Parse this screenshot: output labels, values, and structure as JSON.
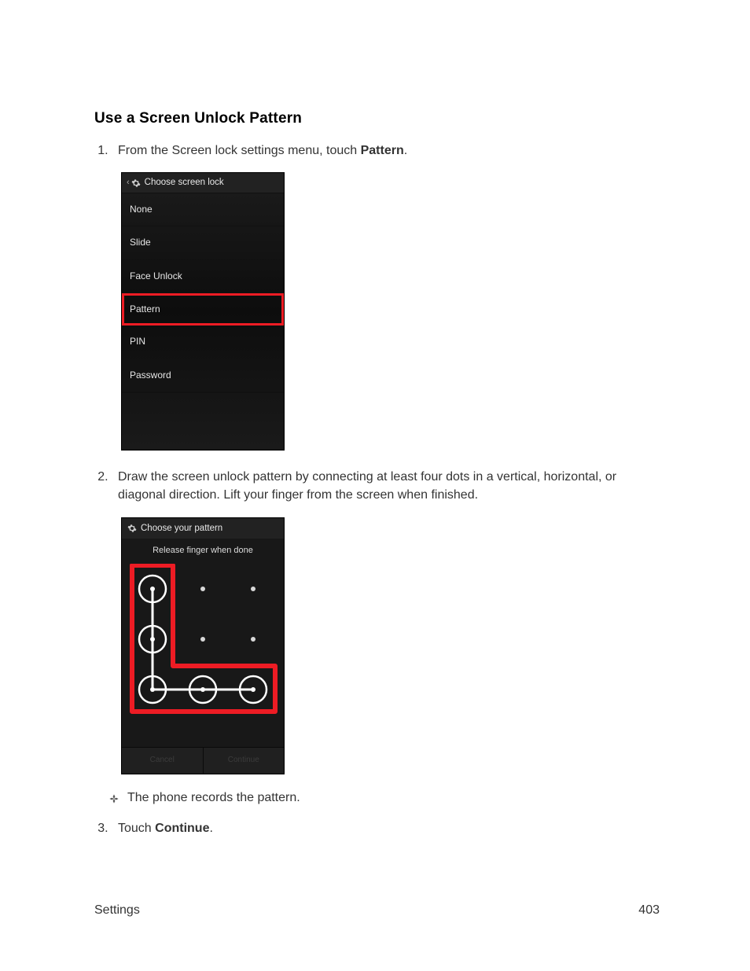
{
  "title": "Use a Screen Unlock Pattern",
  "steps": {
    "one": {
      "prefix": "From the Screen lock settings menu, touch ",
      "bold": "Pattern",
      "suffix": "."
    },
    "two": "Draw the screen unlock pattern by connecting at least four dots in a vertical, horizontal, or diagonal direction. Lift your finger from the screen when finished.",
    "three": {
      "prefix": "Touch ",
      "bold": "Continue",
      "suffix": "."
    }
  },
  "screenshot1": {
    "header": "Choose screen lock",
    "options": [
      "None",
      "Slide",
      "Face Unlock",
      "Pattern",
      "PIN",
      "Password"
    ],
    "highlighted": "Pattern"
  },
  "screenshot2": {
    "header": "Choose your pattern",
    "instruction": "Release finger when done",
    "buttons": [
      "Cancel",
      "Continue"
    ]
  },
  "note": "The phone records the pattern.",
  "footer": {
    "section": "Settings",
    "page": "403"
  }
}
